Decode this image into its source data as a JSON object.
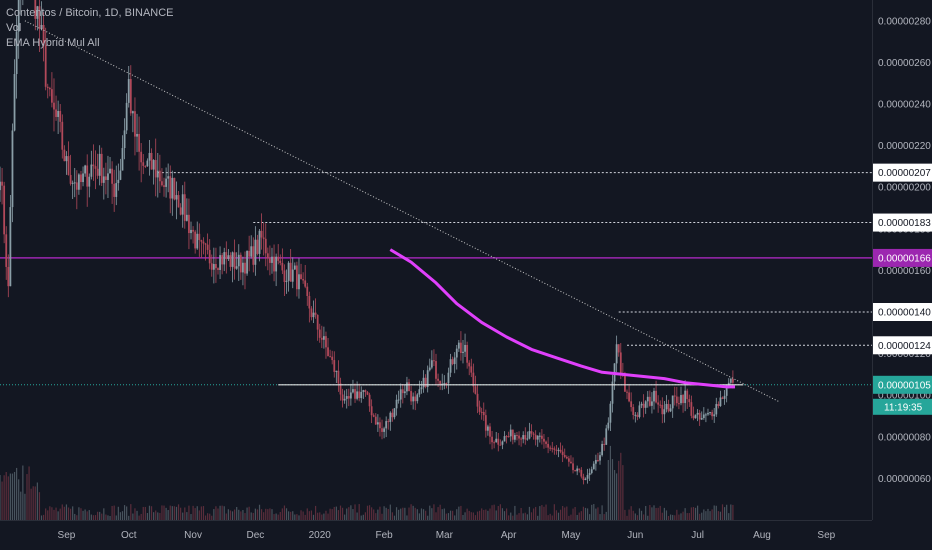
{
  "legend": {
    "symbol_line": "Contentos / Bitcoin, 1D, BINANCE",
    "vol_label": "Vol",
    "ema_label": "EMA Hybrid Mul All"
  },
  "colors": {
    "background": "#131722",
    "up": "#8a9ea7",
    "down": "#b2495a",
    "ema": "#e040fb",
    "purple_level": "#9c27b0",
    "teal": "#26a69a",
    "trend": "#c8c8c8"
  },
  "chart_data": {
    "type": "candlestick",
    "title": "Contentos / Bitcoin, 1D, BINANCE",
    "ylim": [
      4e-07,
      2.9e-06
    ],
    "y_ticks": [
      "0.00000060",
      "0.00000080",
      "0.00000100",
      "0.00000120",
      "0.00000140",
      "0.00000160",
      "0.00000180",
      "0.00000200",
      "0.00000220",
      "0.00000240",
      "0.00000260",
      "0.00000280"
    ],
    "y_tick_values": [
      6e-07,
      8e-07,
      1e-06,
      1.2e-06,
      1.4e-06,
      1.6e-06,
      1.8e-06,
      2e-06,
      2.2e-06,
      2.4e-06,
      2.6e-06,
      2.8e-06
    ],
    "x_labels": [
      {
        "label": "Sep",
        "day": 32
      },
      {
        "label": "Oct",
        "day": 62
      },
      {
        "label": "Nov",
        "day": 93
      },
      {
        "label": "Dec",
        "day": 123
      },
      {
        "label": "2020",
        "day": 154
      },
      {
        "label": "Feb",
        "day": 185
      },
      {
        "label": "Mar",
        "day": 214
      },
      {
        "label": "Apr",
        "day": 245
      },
      {
        "label": "May",
        "day": 275
      },
      {
        "label": "Jun",
        "day": 306
      },
      {
        "label": "Jul",
        "day": 336
      },
      {
        "label": "Aug",
        "day": 367
      },
      {
        "label": "Sep",
        "day": 398
      }
    ],
    "x_range_days": [
      0,
      420
    ],
    "anchors": [
      [
        0,
        2.1e-06
      ],
      [
        4,
        1.5e-06
      ],
      [
        6,
        2.3e-06
      ],
      [
        9,
        2.9e-06
      ],
      [
        13,
        3.2e-06
      ],
      [
        17,
        2.9e-06
      ],
      [
        20,
        2.7e-06
      ],
      [
        24,
        2.4e-06
      ],
      [
        28,
        2.3e-06
      ],
      [
        32,
        2.1e-06
      ],
      [
        38,
        2e-06
      ],
      [
        44,
        2.1e-06
      ],
      [
        48,
        2.1e-06
      ],
      [
        55,
        2e-06
      ],
      [
        58,
        2.1e-06
      ],
      [
        62,
        2.5e-06
      ],
      [
        64,
        2.3e-06
      ],
      [
        68,
        2.1e-06
      ],
      [
        74,
        2.1e-06
      ],
      [
        80,
        2e-06
      ],
      [
        84,
        2e-06
      ],
      [
        88,
        1.9e-06
      ],
      [
        92,
        1.8e-06
      ],
      [
        96,
        1.7e-06
      ],
      [
        101,
        1.66e-06
      ],
      [
        108,
        1.66e-06
      ],
      [
        115,
        1.63e-06
      ],
      [
        120,
        1.65e-06
      ],
      [
        126,
        1.75e-06
      ],
      [
        130,
        1.67e-06
      ],
      [
        136,
        1.6e-06
      ],
      [
        142,
        1.58e-06
      ],
      [
        146,
        1.5e-06
      ],
      [
        150,
        1.4e-06
      ],
      [
        154,
        1.3e-06
      ],
      [
        158,
        1.2e-06
      ],
      [
        162,
        1.1e-06
      ],
      [
        166,
        9.5e-07
      ],
      [
        170,
        1e-06
      ],
      [
        175,
        1.02e-06
      ],
      [
        180,
        9e-07
      ],
      [
        184,
        8.2e-07
      ],
      [
        188,
        9e-07
      ],
      [
        192,
        1e-06
      ],
      [
        196,
        1.05e-06
      ],
      [
        200,
        9.5e-07
      ],
      [
        204,
        1.05e-06
      ],
      [
        208,
        1.15e-06
      ],
      [
        212,
        1.08e-06
      ],
      [
        216,
        1.1e-06
      ],
      [
        220,
        1.25e-06
      ],
      [
        224,
        1.2e-06
      ],
      [
        228,
        1.05e-06
      ],
      [
        232,
        9e-07
      ],
      [
        236,
        8e-07
      ],
      [
        240,
        7.8e-07
      ],
      [
        244,
        8e-07
      ],
      [
        250,
        8.2e-07
      ],
      [
        256,
        8e-07
      ],
      [
        260,
        7.8e-07
      ],
      [
        265,
        7.5e-07
      ],
      [
        270,
        7.2e-07
      ],
      [
        275,
        6.5e-07
      ],
      [
        279,
        6.2e-07
      ],
      [
        283,
        6e-07
      ],
      [
        286,
        6.5e-07
      ],
      [
        290,
        7.5e-07
      ],
      [
        293,
        8.5e-07
      ],
      [
        295,
        1.05e-06
      ],
      [
        297,
        1.25e-06
      ],
      [
        299,
        1.1e-06
      ],
      [
        302,
        1e-06
      ],
      [
        306,
        9e-07
      ],
      [
        310,
        9.5e-07
      ],
      [
        316,
        1e-06
      ],
      [
        320,
        9.2e-07
      ],
      [
        325,
        9.8e-07
      ],
      [
        330,
        1e-06
      ],
      [
        334,
        9e-07
      ],
      [
        337,
        8.8e-07
      ],
      [
        341,
        9e-07
      ],
      [
        345,
        9.5e-07
      ],
      [
        348,
        1e-06
      ],
      [
        351,
        1.05e-06
      ],
      [
        353,
        1.06e-06
      ]
    ],
    "ema_points": [
      [
        188,
        1.7e-06
      ],
      [
        198,
        1.64e-06
      ],
      [
        210,
        1.54e-06
      ],
      [
        220,
        1.44e-06
      ],
      [
        232,
        1.35e-06
      ],
      [
        244,
        1.28e-06
      ],
      [
        256,
        1.22e-06
      ],
      [
        268,
        1.18e-06
      ],
      [
        280,
        1.14e-06
      ],
      [
        290,
        1.11e-06
      ],
      [
        300,
        1.1e-06
      ],
      [
        310,
        1.09e-06
      ],
      [
        320,
        1.08e-06
      ],
      [
        330,
        1.06e-06
      ],
      [
        340,
        1.05e-06
      ],
      [
        350,
        1.04e-06
      ],
      [
        354,
        1.04e-06
      ]
    ],
    "trendline": [
      [
        12,
        2.8e-06
      ],
      [
        375,
        9.7e-07
      ]
    ],
    "h_levels": [
      {
        "value": 2.07e-06,
        "label": "0.00000207",
        "from_day": 76,
        "style": "dotted",
        "kind": "white"
      },
      {
        "value": 1.83e-06,
        "label": "0.00000183",
        "from_day": 122,
        "style": "dotted",
        "kind": "white"
      },
      {
        "value": 1.66e-06,
        "label": "0.00000166",
        "from_day": 0,
        "style": "solid",
        "kind": "purple"
      },
      {
        "value": 1.4e-06,
        "label": "0.00000140",
        "from_day": 298,
        "style": "dotted",
        "kind": "white"
      },
      {
        "value": 1.24e-06,
        "label": "0.00000124",
        "from_day": 302,
        "style": "dotted",
        "kind": "white"
      },
      {
        "value": 1.05e-06,
        "label": "0.00000105",
        "from_day": 0,
        "style": "dotted",
        "kind": "teal"
      }
    ],
    "support_line": {
      "value": 1.05e-06,
      "from_day": 134,
      "to_day": 358
    },
    "countdown": "11:19:35"
  }
}
